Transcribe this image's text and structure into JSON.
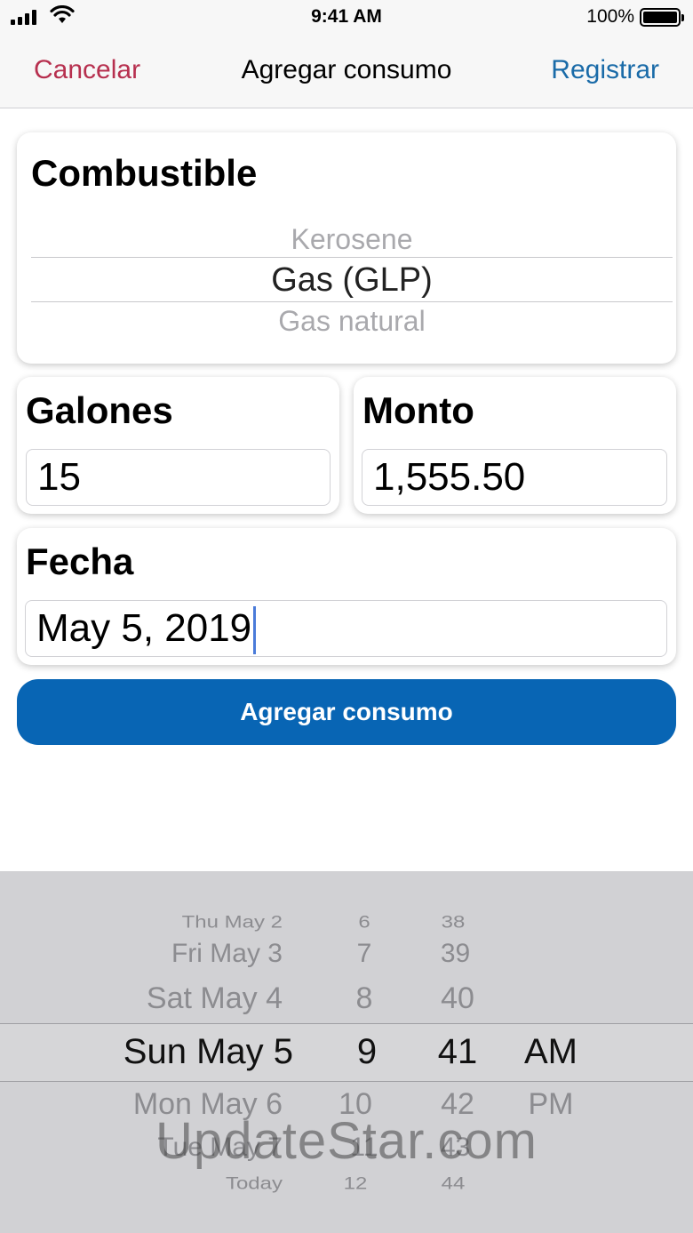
{
  "status_bar": {
    "time": "9:41 AM",
    "battery": "100%"
  },
  "nav": {
    "cancel": "Cancelar",
    "title": "Agregar consumo",
    "register": "Registrar"
  },
  "fuel_card": {
    "title": "Combustible",
    "options": [
      "Kerosene",
      "Gas (GLP)",
      "Gas natural"
    ],
    "selected": "Gas (GLP)"
  },
  "gallons_card": {
    "title": "Galones",
    "value": "15"
  },
  "amount_card": {
    "title": "Monto",
    "value": "1,555.50"
  },
  "date_card": {
    "title": "Fecha",
    "value": "May 5, 2019"
  },
  "add_button": "Agregar consumo",
  "date_picker": {
    "days": [
      "Thu May 2",
      "Fri May 3",
      "Sat May 4",
      "Sun May 5",
      "Mon May 6",
      "Tue May 7",
      "Today"
    ],
    "hours": [
      "6",
      "7",
      "8",
      "9",
      "10",
      "11",
      "12"
    ],
    "minutes": [
      "38",
      "39",
      "40",
      "41",
      "42",
      "43",
      "44"
    ],
    "meridiem": [
      "AM",
      "PM"
    ],
    "selected": {
      "day": "Sun May 5",
      "hour": "9",
      "minute": "41",
      "meridiem": "AM"
    }
  },
  "watermark": "UpdateStar.com"
}
